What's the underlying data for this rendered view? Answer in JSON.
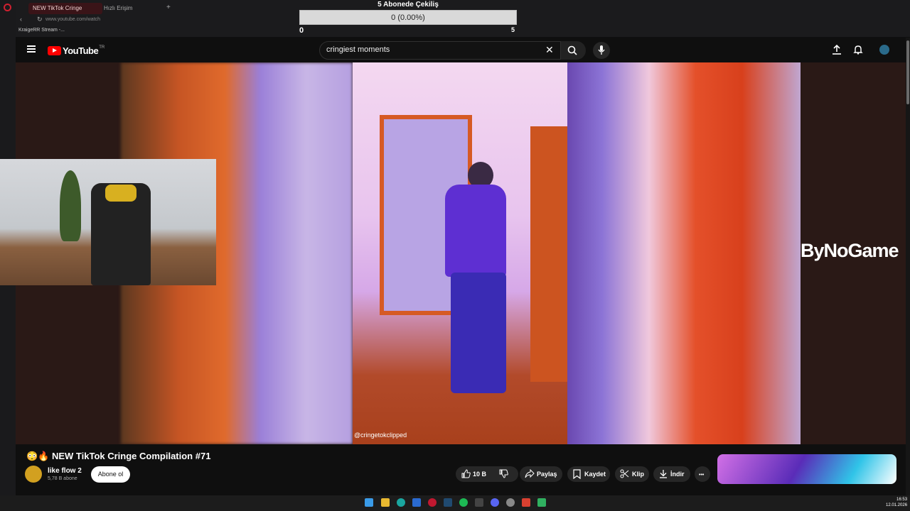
{
  "browser": {
    "tabs": [
      {
        "label": "NEW TikTok Cringe"
      },
      {
        "label": "Hızlı Erişim"
      }
    ],
    "address": "www.youtube.com/watch",
    "bookmark": "KraigeRR Stream -..."
  },
  "overlay": {
    "title": "5 Abonede Çekiliş",
    "progress_text": "0 (0.00%)",
    "progress": 0,
    "min": "0",
    "max": "5"
  },
  "youtube": {
    "logo_text": "YouTube",
    "logo_region": "TR",
    "search_value": "cringiest moments"
  },
  "video": {
    "watermark": "@cringetokclipped",
    "sponsor": "ByNoGame"
  },
  "details": {
    "title": "😳🔥 NEW TikTok Cringe Compilation #71",
    "channel_name": "like flow 2",
    "channel_subs": "5,78 B abone",
    "subscribe_label": "Abone ol",
    "like_count": "10 B",
    "share_label": "Paylaş",
    "save_label": "Kaydet",
    "clip_label": "Klip",
    "download_label": "İndir",
    "more_label": "•••"
  },
  "taskbar": {
    "time": "16:53",
    "date": "12.01.2026"
  },
  "colors": {
    "accent": "#ff0000",
    "background": "#0f0f0f"
  }
}
